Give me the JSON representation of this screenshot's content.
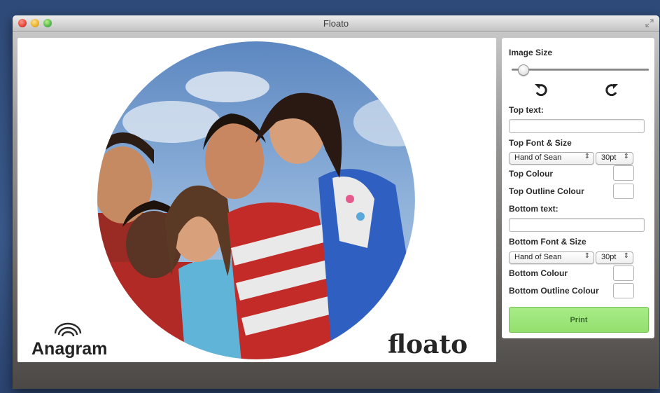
{
  "window": {
    "title": "Floato"
  },
  "canvas": {
    "brand_left": "Anagram",
    "brand_right": "floato"
  },
  "panel": {
    "image_size_label": "Image Size",
    "image_size_value": 0.05,
    "top_text_label": "Top text:",
    "top_text_value": "",
    "top_font_label": "Top Font & Size",
    "top_font": "Hand of Sean",
    "top_size": "30pt",
    "top_colour_label": "Top Colour",
    "top_outline_label": "Top Outline Colour",
    "bottom_text_label": "Bottom text:",
    "bottom_text_value": "",
    "bottom_font_label": "Bottom Font & Size",
    "bottom_font": "Hand of Sean",
    "bottom_size": "30pt",
    "bottom_colour_label": "Bottom Colour",
    "bottom_outline_label": "Bottom Outline Colour",
    "print_label": "Print"
  },
  "colors": {
    "print_button": "#9ae576",
    "accent_desktop": "#3a5a8c"
  },
  "icons": [
    "rotate-left-icon",
    "rotate-right-icon",
    "fullscreen-icon",
    "anagram-logo",
    "floato-logo"
  ]
}
